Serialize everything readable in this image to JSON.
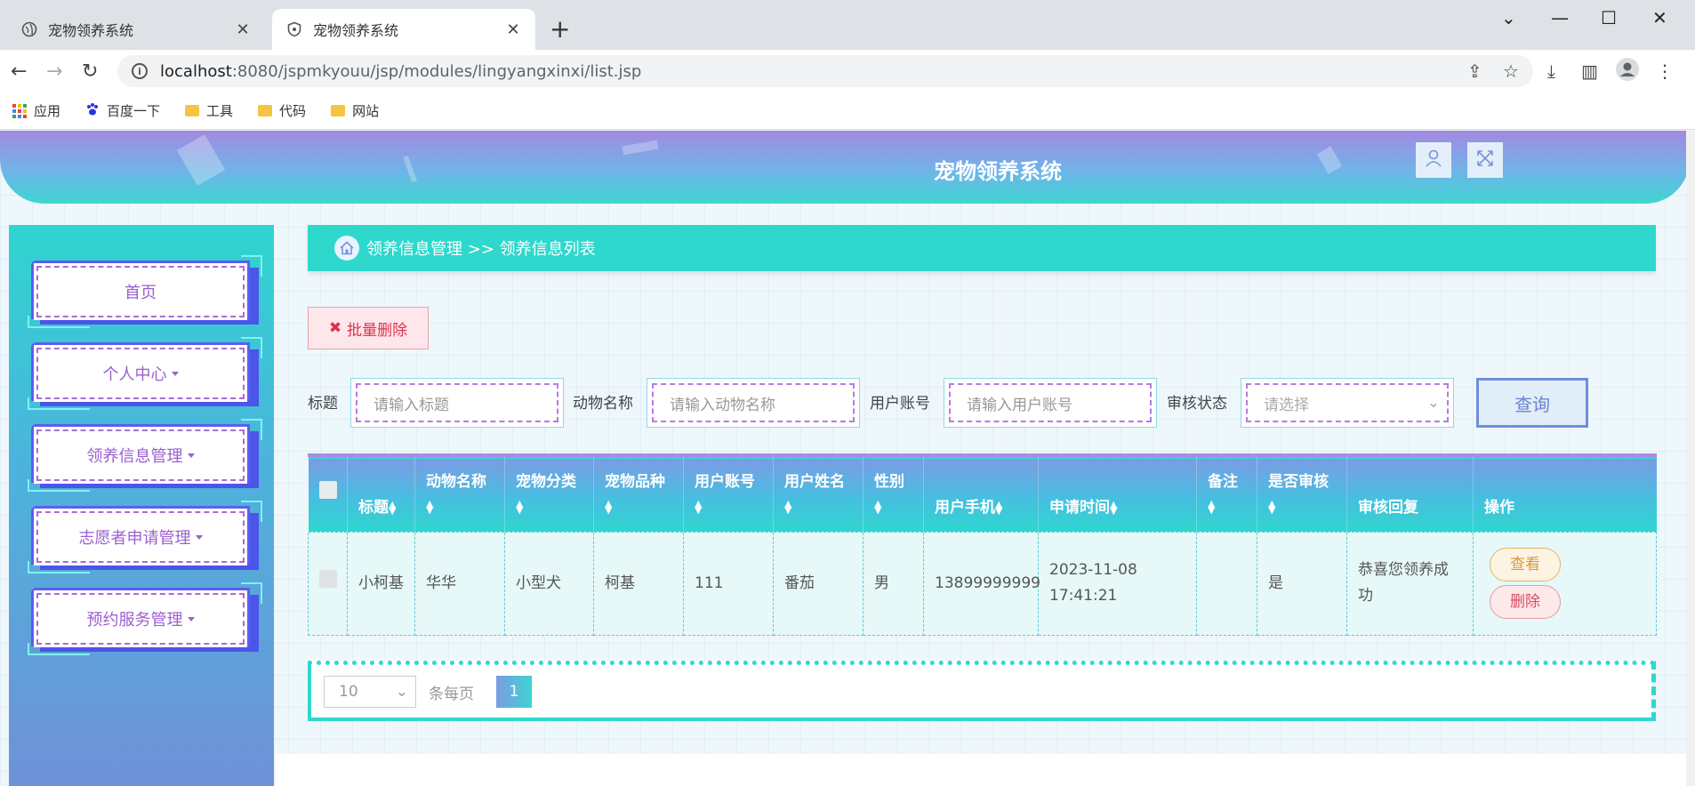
{
  "browser": {
    "tabs": [
      {
        "title": "宠物领养系统",
        "active": false
      },
      {
        "title": "宠物领养系统",
        "active": true
      }
    ],
    "url_host": "localhost",
    "url_path": ":8080/jspmkyouu/jsp/modules/lingyangxinxi/list.jsp",
    "bookmarks": [
      "应用",
      "百度一下",
      "工具",
      "代码",
      "网站"
    ]
  },
  "header": {
    "title": "宠物领养系统"
  },
  "sidebar": {
    "items": [
      {
        "label": "首页",
        "has_caret": false
      },
      {
        "label": "个人中心",
        "has_caret": true
      },
      {
        "label": "领养信息管理",
        "has_caret": true
      },
      {
        "label": "志愿者申请管理",
        "has_caret": true
      },
      {
        "label": "预约服务管理",
        "has_caret": true
      }
    ]
  },
  "breadcrumb": {
    "text": "领养信息管理 >> 领养信息列表"
  },
  "toolbar": {
    "batch_delete": "批量删除"
  },
  "filters": {
    "title_label": "标题",
    "title_placeholder": "请输入标题",
    "animal_label": "动物名称",
    "animal_placeholder": "请输入动物名称",
    "account_label": "用户账号",
    "account_placeholder": "请输入用户账号",
    "status_label": "审核状态",
    "status_placeholder": "请选择",
    "query_button": "查询"
  },
  "table": {
    "headers": [
      "标题",
      "动物名称",
      "宠物分类",
      "宠物品种",
      "用户账号",
      "用户姓名",
      "性别",
      "用户手机",
      "申请时间",
      "备注",
      "是否审核",
      "审核回复",
      "操作"
    ],
    "rows": [
      {
        "title": "小柯基",
        "animal": "华华",
        "category": "小型犬",
        "breed": "柯基",
        "account": "111",
        "name": "番茄",
        "gender": "男",
        "phone": "13899999999",
        "time": "2023-11-08 17:41:21",
        "remark": "",
        "reviewed": "是",
        "reply": "恭喜您领养成功",
        "view_label": "查看",
        "delete_label": "删除"
      }
    ]
  },
  "pagination": {
    "page_size": "10",
    "per_page_label": "条每页",
    "current_page": "1"
  }
}
